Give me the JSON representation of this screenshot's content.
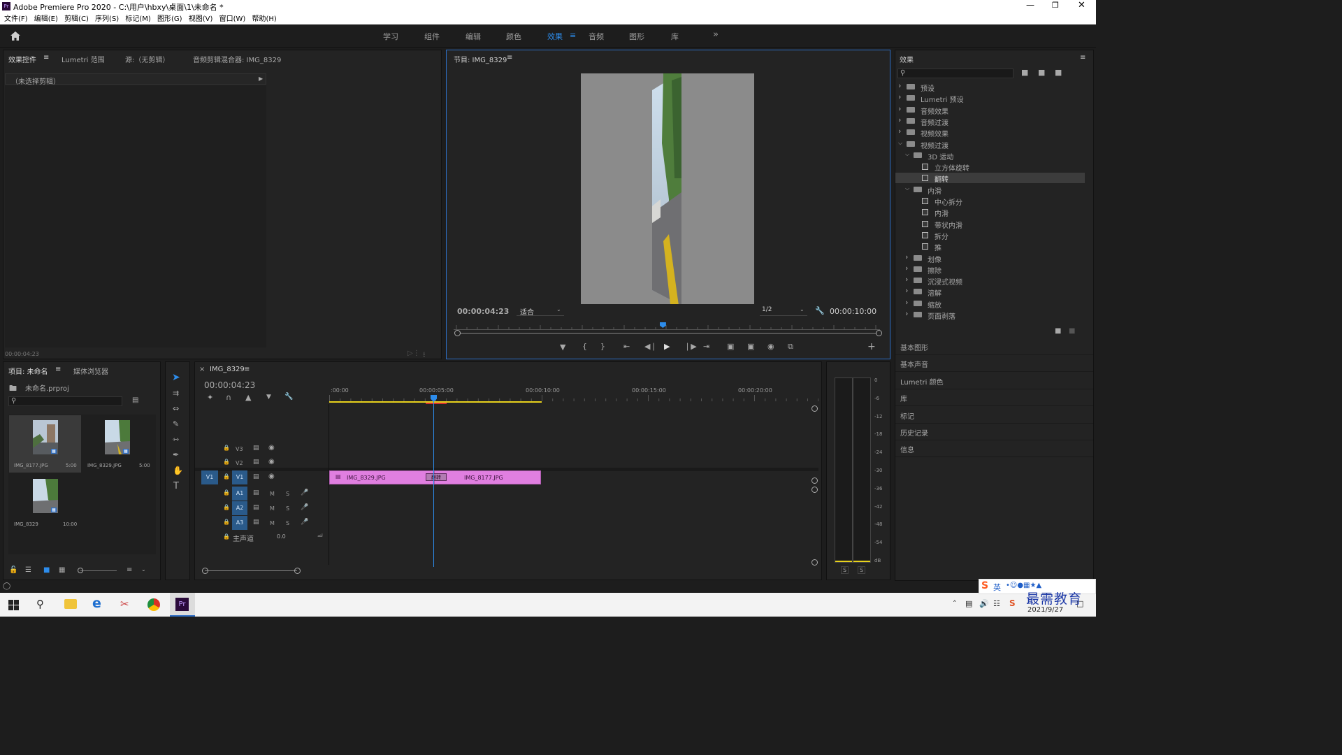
{
  "window": {
    "title": "Adobe Premiere Pro 2020 - C:\\用户\\hbxy\\桌面\\1\\未命名 *",
    "app_icon": "Pr"
  },
  "menu": [
    "文件(F)",
    "编辑(E)",
    "剪辑(C)",
    "序列(S)",
    "标记(M)",
    "图形(G)",
    "视图(V)",
    "窗口(W)",
    "帮助(H)"
  ],
  "workspaces": {
    "tabs": [
      "学习",
      "组件",
      "编辑",
      "颜色",
      "效果",
      "音频",
      "图形",
      "库"
    ],
    "active": "效果",
    "more": "»"
  },
  "source_panel": {
    "tabs": [
      "效果控件",
      "Lumetri 范围",
      "源:（无剪辑）",
      "音频剪辑混合器: IMG_8329"
    ],
    "no_clip": "（未选择剪辑）",
    "timecode": "00:00:04:23"
  },
  "program_monitor": {
    "title": "节目: IMG_8329",
    "timecode": "00:00:04:23",
    "fit": "适合",
    "resolution": "1/2",
    "duration": "00:00:10:00",
    "playhead_fraction": 0.49
  },
  "effects_panel": {
    "title": "效果",
    "tree": [
      {
        "label": "预设",
        "level": 0,
        "state": "closed",
        "kind": "star-folder"
      },
      {
        "label": "Lumetri 预设",
        "level": 0,
        "state": "closed",
        "kind": "star-folder"
      },
      {
        "label": "音频效果",
        "level": 0,
        "state": "closed",
        "kind": "folder"
      },
      {
        "label": "音频过渡",
        "level": 0,
        "state": "closed",
        "kind": "folder"
      },
      {
        "label": "视频效果",
        "level": 0,
        "state": "closed",
        "kind": "folder"
      },
      {
        "label": "视频过渡",
        "level": 0,
        "state": "open",
        "kind": "folder"
      },
      {
        "label": "3D 运动",
        "level": 1,
        "state": "open",
        "kind": "folder"
      },
      {
        "label": "立方体旋转",
        "level": 2,
        "state": "",
        "kind": "effect"
      },
      {
        "label": "翻转",
        "level": 2,
        "state": "",
        "kind": "effect",
        "selected": true
      },
      {
        "label": "内滑",
        "level": 1,
        "state": "open",
        "kind": "folder"
      },
      {
        "label": "中心拆分",
        "level": 2,
        "state": "",
        "kind": "effect"
      },
      {
        "label": "内滑",
        "level": 2,
        "state": "",
        "kind": "effect"
      },
      {
        "label": "带状内滑",
        "level": 2,
        "state": "",
        "kind": "effect"
      },
      {
        "label": "拆分",
        "level": 2,
        "state": "",
        "kind": "effect"
      },
      {
        "label": "推",
        "level": 2,
        "state": "",
        "kind": "effect"
      },
      {
        "label": "划像",
        "level": 1,
        "state": "closed",
        "kind": "folder"
      },
      {
        "label": "擦除",
        "level": 1,
        "state": "closed",
        "kind": "folder"
      },
      {
        "label": "沉浸式视频",
        "level": 1,
        "state": "closed",
        "kind": "folder"
      },
      {
        "label": "溶解",
        "level": 1,
        "state": "closed",
        "kind": "folder"
      },
      {
        "label": "缩放",
        "level": 1,
        "state": "closed",
        "kind": "folder"
      },
      {
        "label": "页面剥落",
        "level": 1,
        "state": "closed",
        "kind": "folder"
      }
    ],
    "sections": [
      "基本图形",
      "基本声音",
      "Lumetri 颜色",
      "库",
      "标记",
      "历史记录",
      "信息"
    ]
  },
  "project_panel": {
    "tabs": [
      "项目: 未命名",
      "媒体浏览器"
    ],
    "project_file": "未命名.prproj",
    "items": [
      {
        "name": "IMG_8177.JPG",
        "duration": "5:00"
      },
      {
        "name": "IMG_8329.JPG",
        "duration": "5:00"
      },
      {
        "name": "IMG_8329",
        "duration": "10:00"
      }
    ]
  },
  "timeline": {
    "tab": "IMG_8329",
    "timecode": "00:00:04:23",
    "ruler": [
      ":00:00",
      "00:00:05:00",
      "00:00:10:00",
      "00:00:15:00",
      "00:00:20:00"
    ],
    "video_tracks": [
      "V3",
      "V2",
      "V1"
    ],
    "audio_tracks": [
      "A1",
      "A2",
      "A3"
    ],
    "source_patch": "V1",
    "master_label": "主声道",
    "master_value": "0.0",
    "clips": [
      {
        "name": "IMG_8329.JPG",
        "track": "V1"
      },
      {
        "name": "IMG_8177.JPG",
        "track": "V1"
      }
    ],
    "transition": "翻转",
    "playhead_time": "00:00:04:23"
  },
  "audio_meter": {
    "scale": [
      "0",
      "-6",
      "-12",
      "-18",
      "-24",
      "-30",
      "-36",
      "-42",
      "-48",
      "-54",
      "dB"
    ],
    "solo": [
      "S",
      "S"
    ]
  },
  "taskbar": {
    "ime": "英",
    "date": "2021/9/27",
    "watermark": "最需教育"
  },
  "colors": {
    "accent": "#2d8ceb",
    "clip": "#e07fe0",
    "work_area": "#e8d21c",
    "panel_focus": "#2d6ec5"
  }
}
